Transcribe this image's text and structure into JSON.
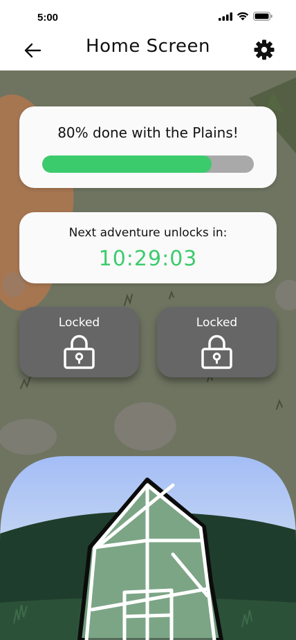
{
  "status_bar": {
    "time": "5:00"
  },
  "nav": {
    "title": "Home Screen"
  },
  "progress": {
    "text": "80% done with the Plains!",
    "percent": 80,
    "fill_color": "#3ccb6c",
    "track_color": "#a9a9a9"
  },
  "timer": {
    "label": "Next adventure unlocks in:",
    "value": "10:29:03",
    "color": "#3ccb6c"
  },
  "locked_tiles": [
    {
      "label": "Locked",
      "icon": "lock-icon"
    },
    {
      "label": "Locked",
      "icon": "lock-icon"
    }
  ],
  "icons": {
    "back": "arrow-left-icon",
    "settings": "gear-icon"
  },
  "colors": {
    "background": "#6f7461",
    "card": "#fafafa",
    "tile": "#666666"
  }
}
